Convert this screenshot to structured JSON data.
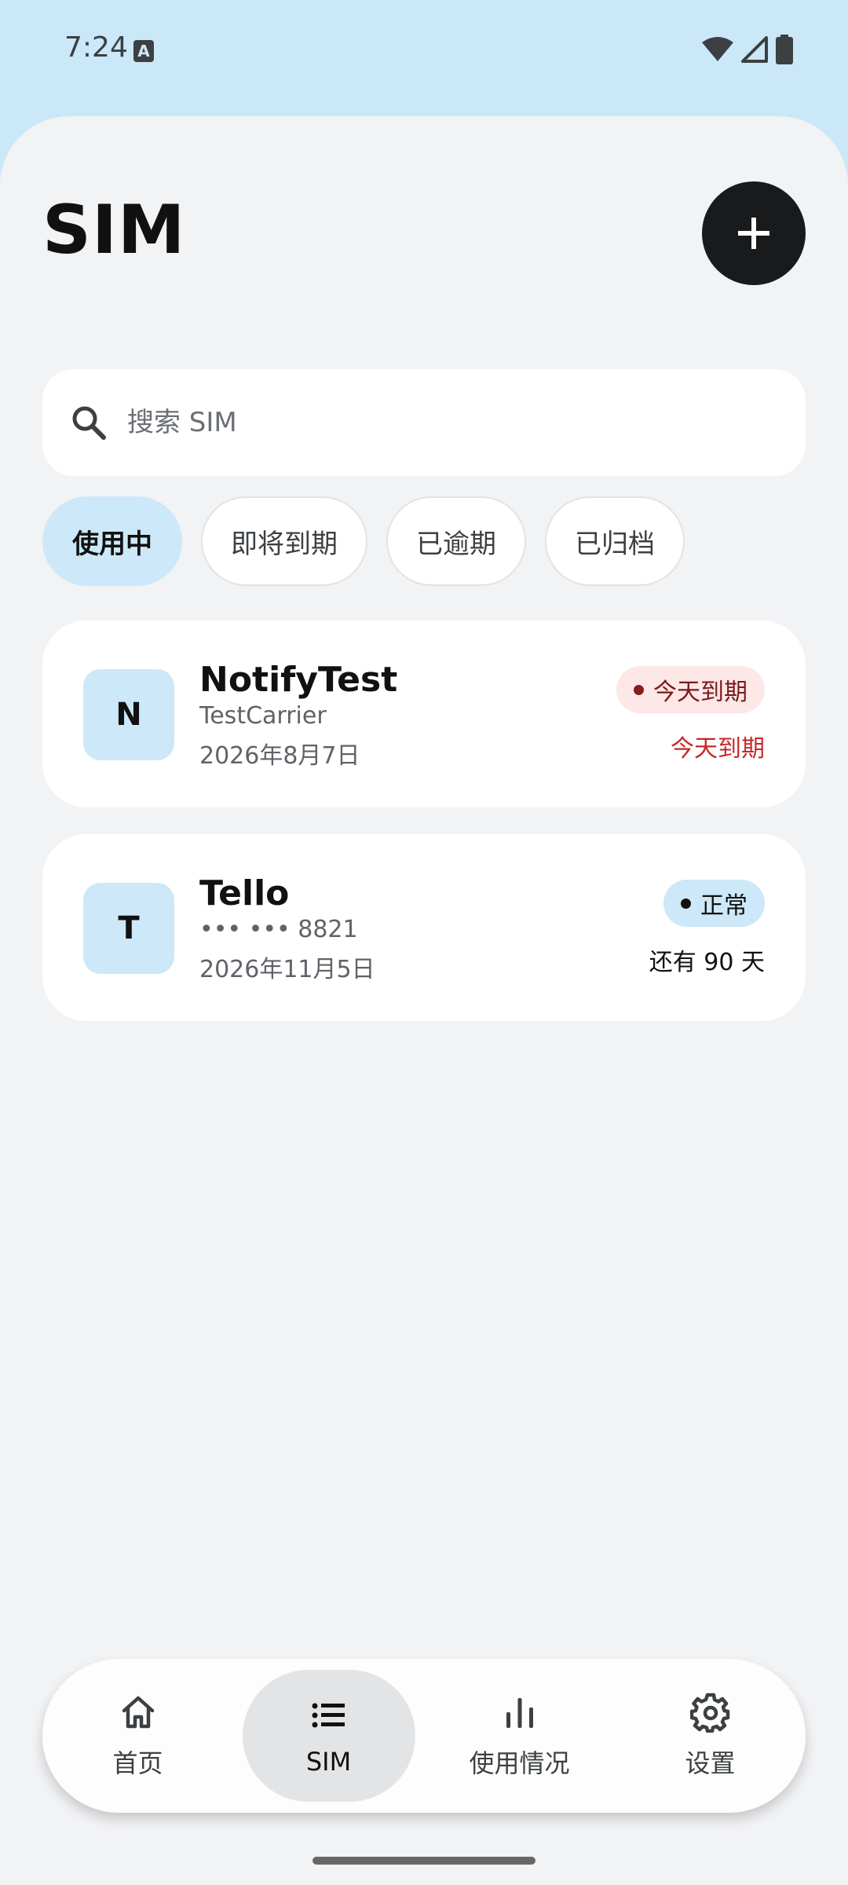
{
  "status": {
    "time": "7:24",
    "a_badge": "A"
  },
  "header": {
    "title": "SIM"
  },
  "search": {
    "placeholder": "搜索 SIM"
  },
  "filters": [
    {
      "label": "使用中",
      "active": true
    },
    {
      "label": "即将到期",
      "active": false
    },
    {
      "label": "已逾期",
      "active": false
    },
    {
      "label": "已归档",
      "active": false
    }
  ],
  "cards": [
    {
      "initial": "N",
      "name": "NotifyTest",
      "carrier": "TestCarrier",
      "date": "2026年8月7日",
      "badge": "今天到期",
      "remaining": "今天到期"
    },
    {
      "initial": "T",
      "name": "Tello",
      "carrier": "••• ••• 8821",
      "date": "2026年11月5日",
      "badge": "正常",
      "remaining": "还有 90 天"
    }
  ],
  "nav": [
    {
      "label": "首页",
      "icon": "home-icon"
    },
    {
      "label": "SIM",
      "icon": "list-icon"
    },
    {
      "label": "使用情况",
      "icon": "bar-chart-icon"
    },
    {
      "label": "设置",
      "icon": "gear-icon"
    }
  ],
  "colors": {
    "accent": "#cde8f8",
    "background": "#f2f3f5",
    "warning": "#c62828",
    "fab": "#181a1b"
  }
}
